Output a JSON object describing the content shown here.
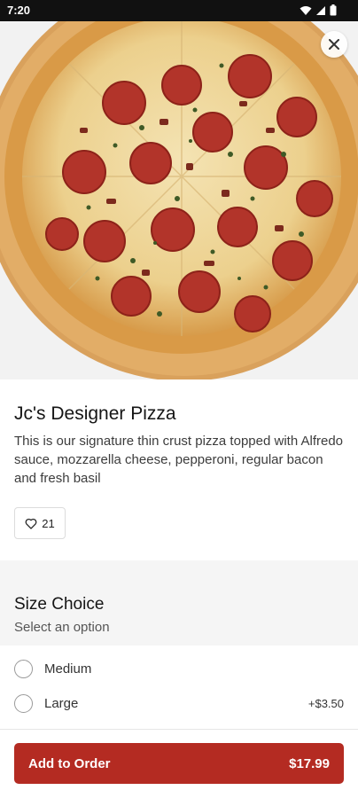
{
  "status_bar": {
    "time": "7:20",
    "icons": [
      "wifi-icon",
      "signal-icon",
      "battery-icon"
    ]
  },
  "hero": {
    "image_alt": "Pizza topped with pepperoni, bacon and basil on a wooden board",
    "close_icon": "close-icon"
  },
  "item": {
    "title": "Jc's Designer Pizza",
    "description": "This is our signature thin crust pizza topped with Alfredo sauce, mozzarella cheese, pepperoni, regular bacon and fresh basil",
    "likes": "21"
  },
  "size_section": {
    "title": "Size Choice",
    "subtitle": "Select an option",
    "options": [
      {
        "label": "Medium",
        "price": ""
      },
      {
        "label": "Large",
        "price": "+$3.50"
      }
    ]
  },
  "footer": {
    "add_label": "Add to Order",
    "price": "$17.99"
  },
  "colors": {
    "accent": "#b42b22",
    "section_bg": "#f5f5f5"
  }
}
